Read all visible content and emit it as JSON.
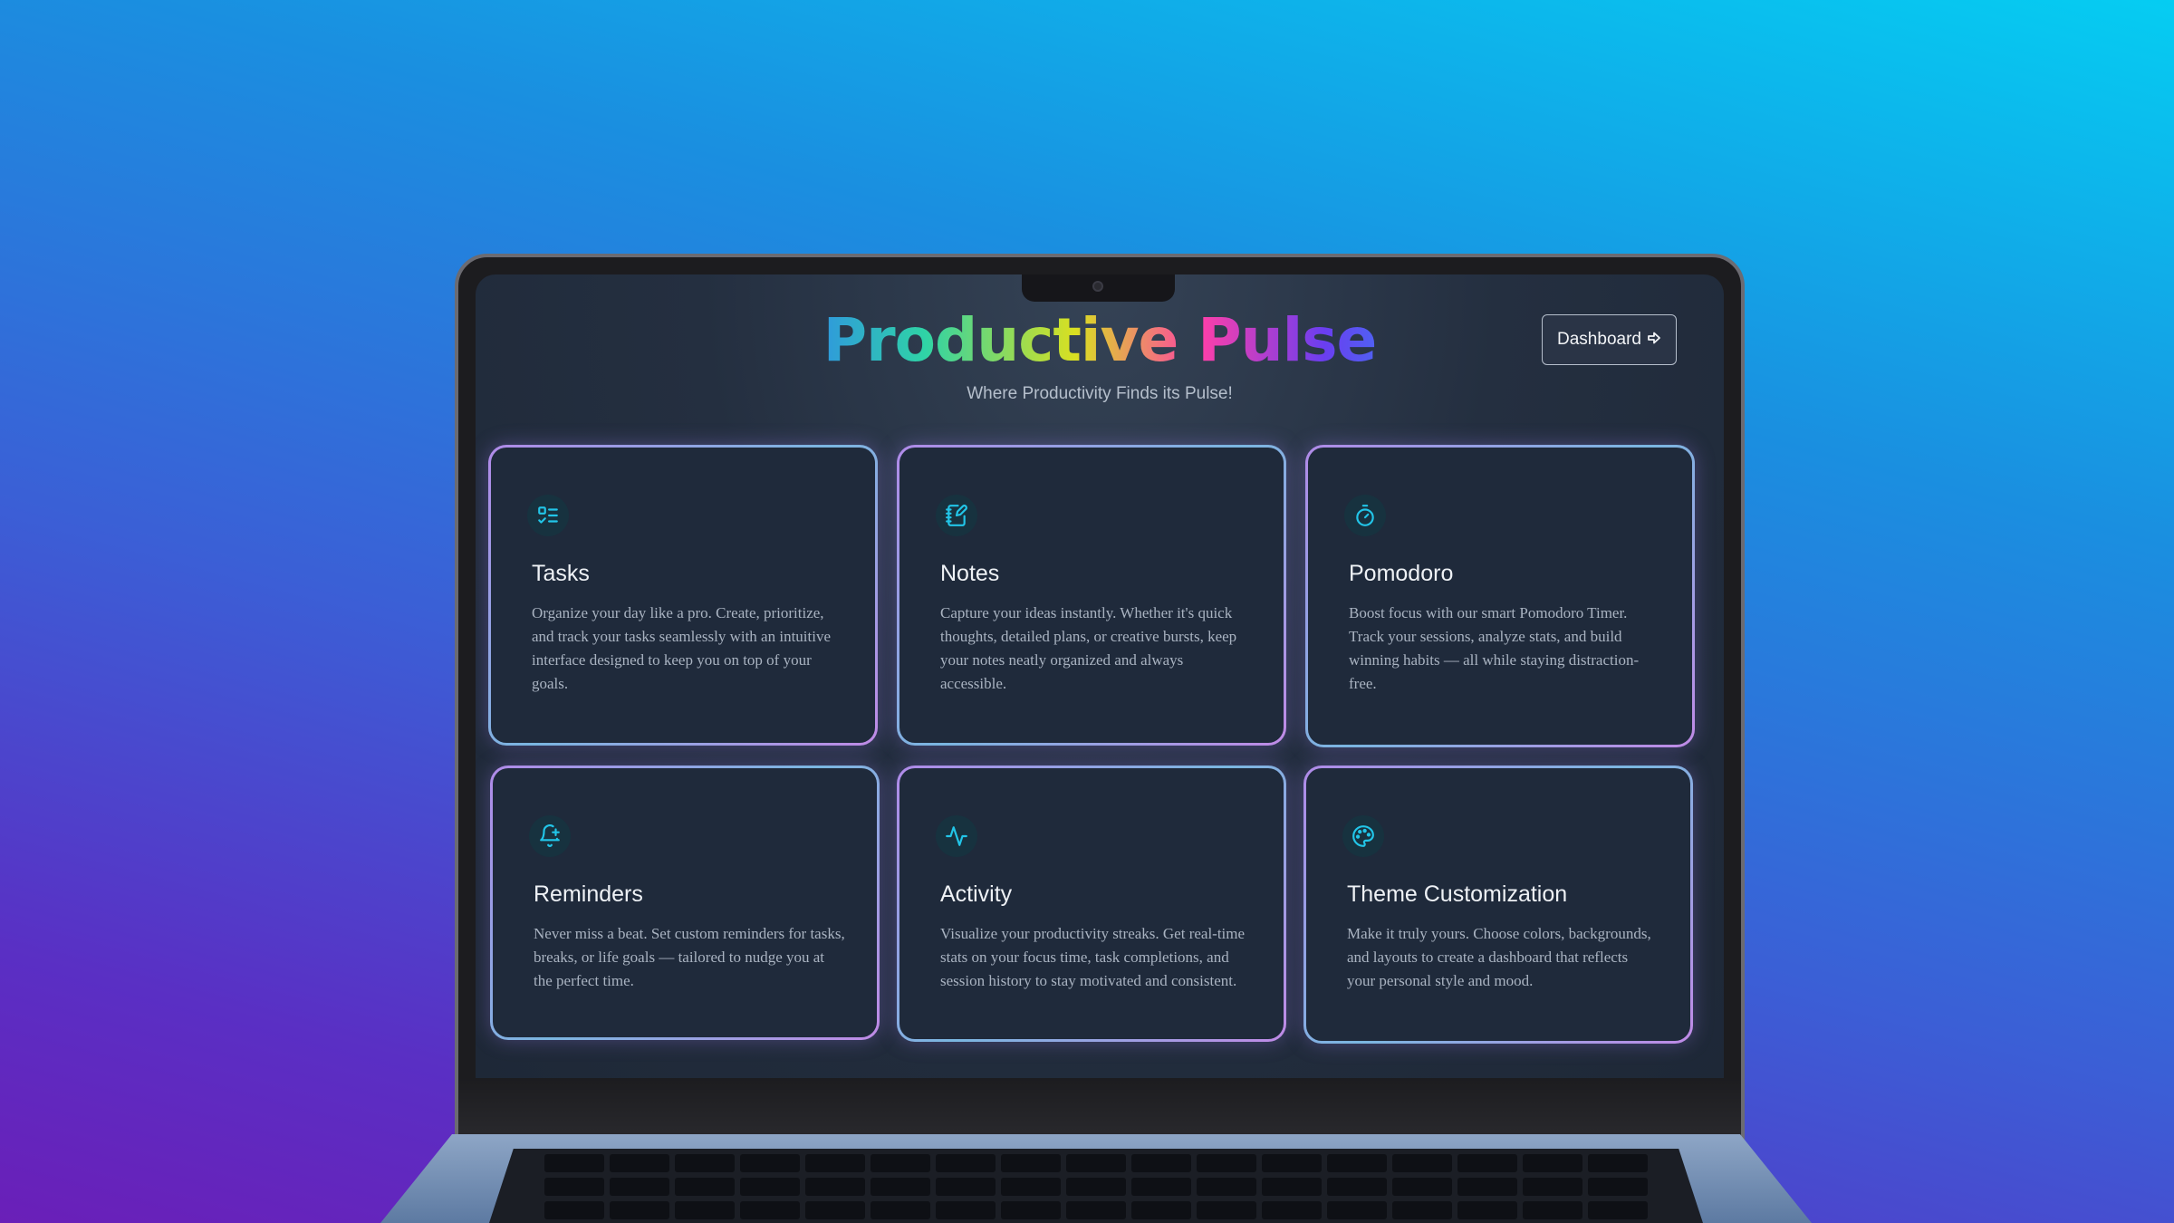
{
  "app": {
    "title": "Productive Pulse",
    "subtitle": "Where Productivity Finds its Pulse!",
    "dashboard_button": "Dashboard"
  },
  "colors": {
    "accent_icon": "#22c5e8",
    "card_bg": "#1f2a3b",
    "screen_bg": "#242f40",
    "card_border": "#b18ae8"
  },
  "cards": [
    {
      "title": "Tasks",
      "icon": "checklist-icon",
      "description": "Organize your day like a pro. Create, prioritize, and track your tasks seamlessly with an intuitive interface designed to keep you on top of your goals."
    },
    {
      "title": "Notes",
      "icon": "notebook-pen-icon",
      "description": "Capture your ideas instantly. Whether it's quick thoughts, detailed plans, or creative bursts, keep your notes neatly organized and always accessible."
    },
    {
      "title": "Pomodoro",
      "icon": "timer-icon",
      "description": "Boost focus with our smart Pomodoro Timer. Track your sessions, analyze stats, and build winning habits — all while staying distraction-free."
    },
    {
      "title": "Reminders",
      "icon": "bell-plus-icon",
      "description": "Never miss a beat. Set custom reminders for tasks, breaks, or life goals — tailored to nudge you at the perfect time."
    },
    {
      "title": "Activity",
      "icon": "activity-pulse-icon",
      "description": "Visualize your productivity streaks. Get real-time stats on your focus time, task completions, and session history to stay motivated and consistent."
    },
    {
      "title": "Theme Customization",
      "icon": "palette-icon",
      "description": "Make it truly yours. Choose colors, backgrounds, and layouts to create a dashboard that reflects your personal style and mood."
    }
  ]
}
